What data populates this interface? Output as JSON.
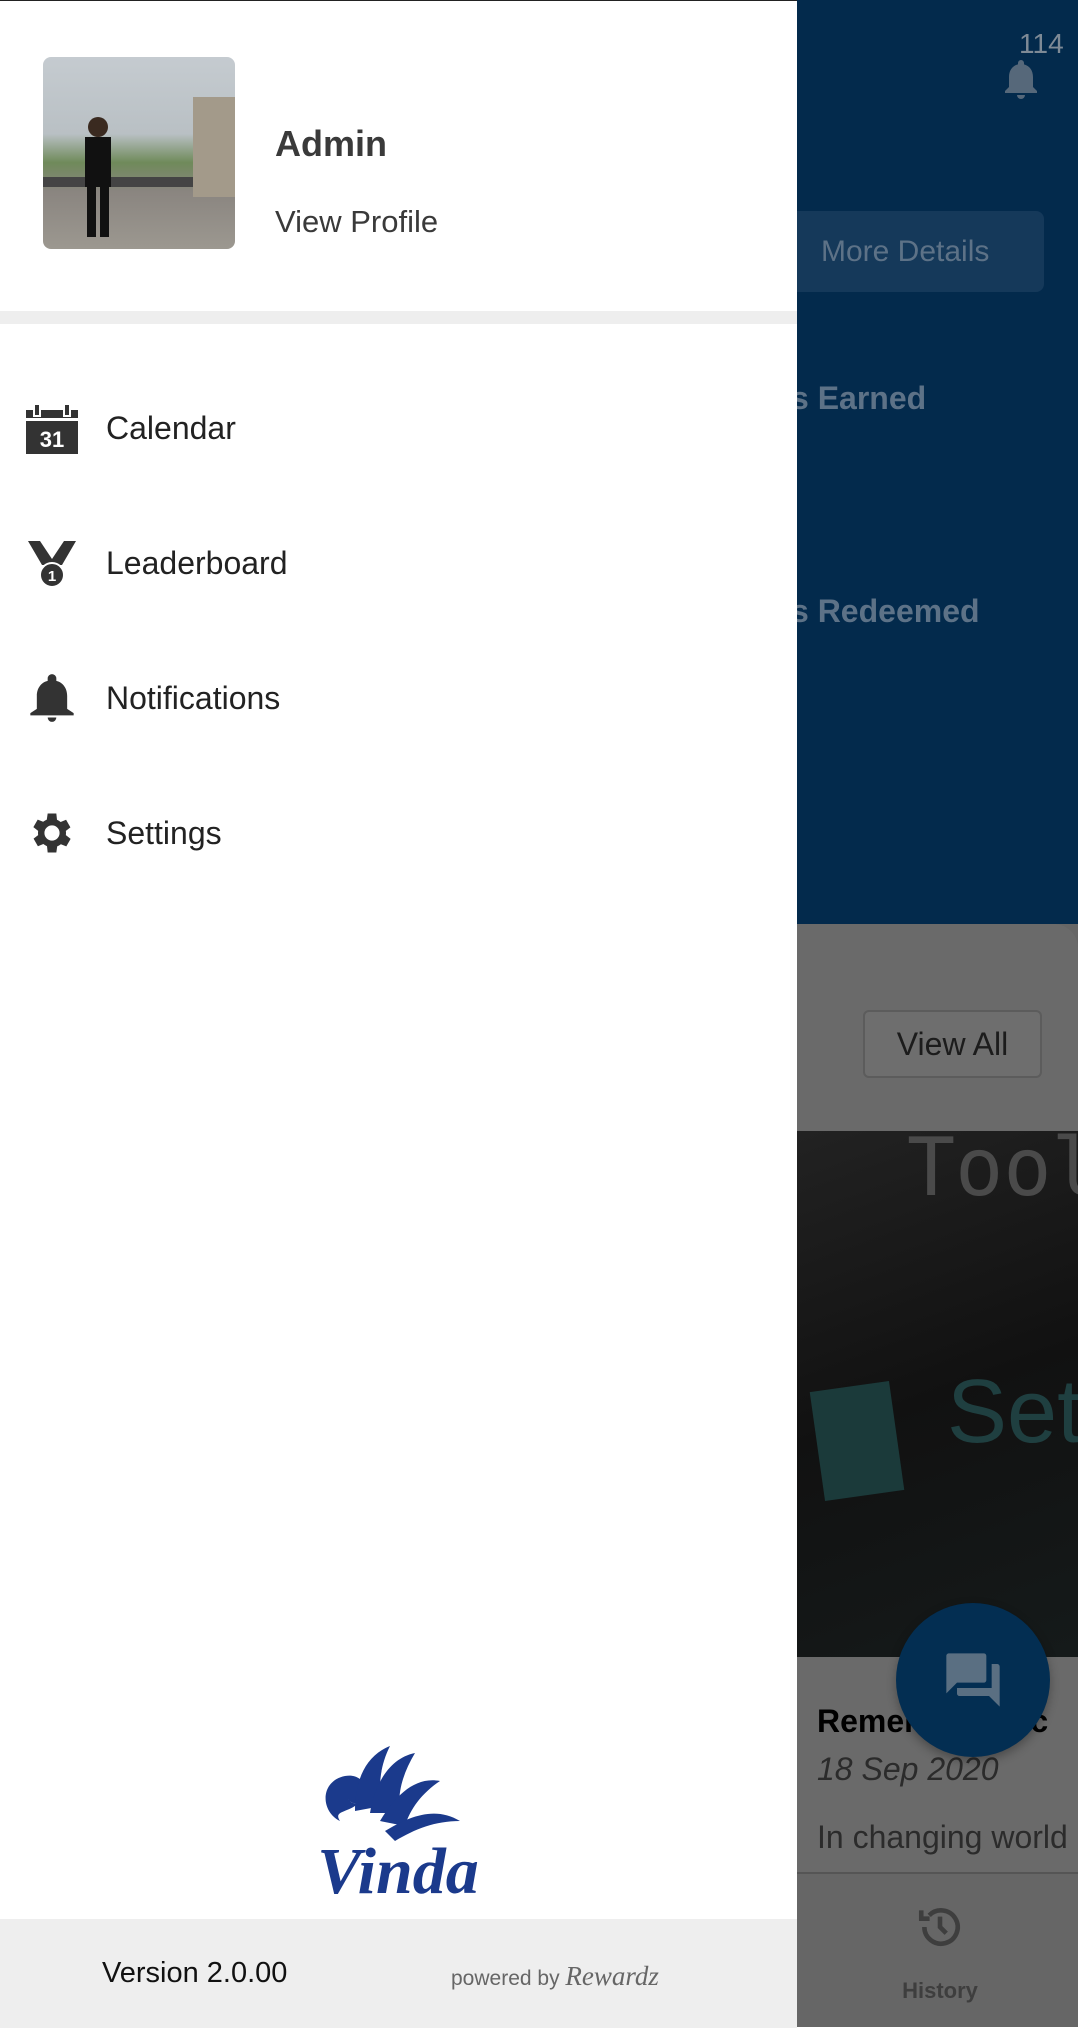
{
  "drawer": {
    "profile": {
      "name": "Admin",
      "view_profile_label": "View Profile"
    },
    "menu": [
      {
        "label": "Calendar",
        "icon": "calendar-icon",
        "icon_text": "31"
      },
      {
        "label": "Leaderboard",
        "icon": "medal-icon",
        "icon_text": "1"
      },
      {
        "label": "Notifications",
        "icon": "bell-icon"
      },
      {
        "label": "Settings",
        "icon": "gear-icon"
      }
    ],
    "logo_text": "Vinda",
    "logo_color": "#1b3a8c",
    "footer": {
      "version": "Version 2.0.00",
      "powered_by": "powered by",
      "brand": "Rewardz"
    }
  },
  "background": {
    "notification_count": "114",
    "more_details_label": "More Details",
    "points_earned_label": "s Earned",
    "points_redeemed_label": "s Redeemed",
    "view_all_label": "View All",
    "card": {
      "title": "Remember to c",
      "date": "18 Sep 2020",
      "excerpt": "In changing world"
    },
    "nav": {
      "history_label": "History"
    },
    "header_color": "#032a4c"
  }
}
